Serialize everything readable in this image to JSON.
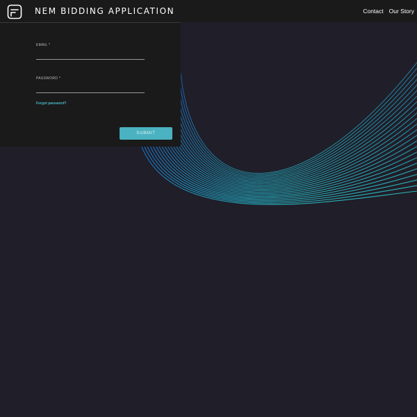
{
  "header": {
    "app_title": "NEM BIDDING APPLICATION",
    "nav": [
      {
        "label": "Contact"
      },
      {
        "label": "Our Story"
      }
    ]
  },
  "login_form": {
    "email_label": "EMAIL *",
    "email_value": "",
    "password_label": "PASSWORD *",
    "password_value": "",
    "forgot_password_label": "Forgot password?",
    "submit_label": "SUBMIT"
  },
  "colors": {
    "background": "#201e28",
    "panel": "#1a1a1a",
    "accent": "#4ab2c0",
    "wave_blue": "#1565c8",
    "wave_teal": "#2ec4b8"
  },
  "icons": {
    "logo": "logo-icon"
  }
}
